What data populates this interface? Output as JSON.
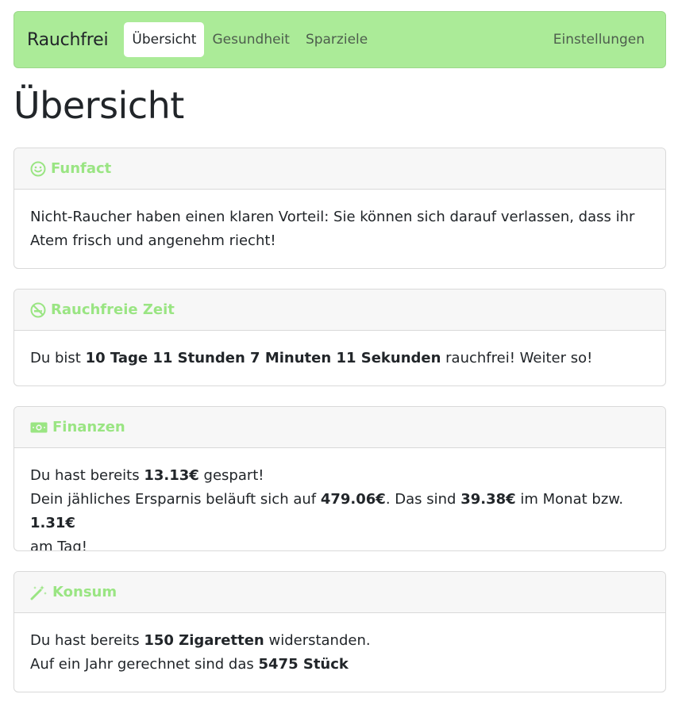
{
  "nav": {
    "brand": "Rauchfrei",
    "links": [
      "Übersicht",
      "Gesundheit",
      "Sparziele"
    ],
    "settings": "Einstellungen"
  },
  "page": {
    "title": "Übersicht"
  },
  "funfact": {
    "title": "Funfact",
    "line1": "Nicht-Raucher haben einen klaren Vorteil: Sie können sich darauf verlassen, dass ihr",
    "line2": "Atem frisch und angenehm riecht!"
  },
  "smokefree": {
    "title": "Rauchfreie Zeit",
    "prefix": "Du bist ",
    "duration": "10 Tage 11 Stunden 7 Minuten 11 Sekunden",
    "suffix": " rauchfrei! Weiter so!"
  },
  "finance": {
    "title": "Finanzen",
    "saved_prefix": "Du hast bereits ",
    "saved_value": "13.13€",
    "saved_suffix": " gespart!",
    "yearly_prefix": "Dein jähliches Ersparnis beläuft sich auf ",
    "yearly_value": "479.06€",
    "monthly_prefix": ". Das sind ",
    "monthly_value": "39.38€",
    "daily_prefix": " im Monat bzw. ",
    "daily_value": "1.31€",
    "daily_suffix": "am Tag!"
  },
  "consumption": {
    "title": "Konsum",
    "resisted_prefix": "Du hast bereits ",
    "resisted_value": "150 Zigaretten",
    "resisted_suffix": " widerstanden.",
    "year_prefix": "Auf ein Jahr gerechnet sind das ",
    "year_value": "5475 Stück"
  },
  "colors": {
    "navbar": "#abeb98",
    "accent": "#9ae583"
  },
  "icons": {
    "funfact": "smile-icon",
    "smokefree": "no-smoking-icon",
    "finance": "money-icon",
    "consumption": "magic-wand-icon"
  }
}
